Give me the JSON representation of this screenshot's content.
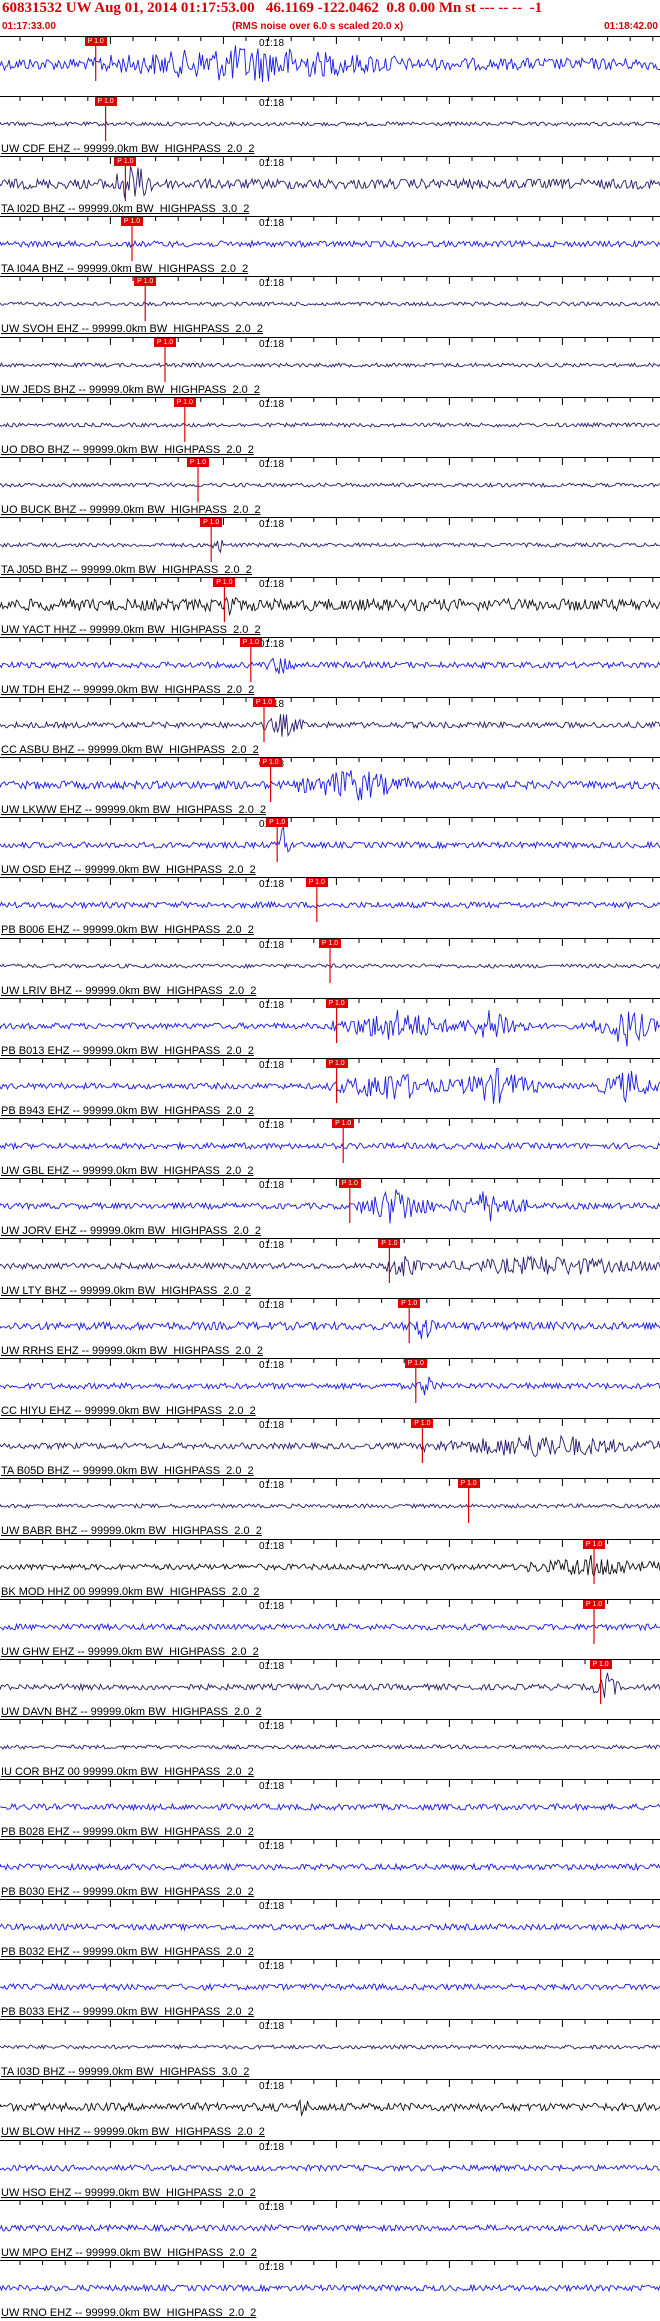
{
  "header": {
    "title": "60831532 UW Aug 01, 2014 01:17:53.00   46.1169 -122.0462  0.8 0.00 Mn st --- -- --  -1",
    "start_time": "01:17:33.00",
    "rms_note": "(RMS noise over 6.0 s scaled 20.0 x)",
    "end_time": "01:18:42.00"
  },
  "tick_label": "01:18",
  "pick_label": "P 1.0",
  "colors": {
    "header": "#d40000",
    "pick": "#e00000",
    "black": "#111111",
    "blue": "#1a1ae6",
    "purple": "#2a1a6e"
  },
  "panels": [
    {
      "station": "",
      "pick": 0.145,
      "amp": 6,
      "color": "blue",
      "burst": [
        [
          0.15,
          0.6,
          14
        ]
      ]
    },
    {
      "station": "UW CDF EHZ -- 99999.0km BW  HIGHPASS  2.0  2",
      "pick": 0.16,
      "amp": 2,
      "color": "purple",
      "burst": []
    },
    {
      "station": "TA I02D BHZ -- 99999.0km BW  HIGHPASS  3.0  2",
      "pick": 0.19,
      "amp": 5,
      "color": "purple",
      "burst": [
        [
          0.16,
          0.24,
          16
        ]
      ]
    },
    {
      "station": "TA I04A BHZ -- 99999.0km BW  HIGHPASS  2.0  2",
      "pick": 0.2,
      "amp": 3,
      "color": "blue",
      "burst": []
    },
    {
      "station": "UW SVOH EHZ -- 99999.0km BW  HIGHPASS  2.0  2",
      "pick": 0.22,
      "amp": 2,
      "color": "purple",
      "burst": []
    },
    {
      "station": "UW JEDS BHZ -- 99999.0km BW  HIGHPASS  2.0  2",
      "pick": 0.25,
      "amp": 2,
      "color": "purple",
      "burst": []
    },
    {
      "station": "UO DBO BHZ -- 99999.0km BW  HIGHPASS  2.0  2",
      "pick": 0.28,
      "amp": 2,
      "color": "purple",
      "burst": []
    },
    {
      "station": "UO BUCK BHZ -- 99999.0km BW  HIGHPASS  2.0  2",
      "pick": 0.3,
      "amp": 2,
      "color": "purple",
      "burst": []
    },
    {
      "station": "TA J05D BHZ -- 99999.0km BW  HIGHPASS  2.0  2",
      "pick": 0.32,
      "amp": 2,
      "color": "purple",
      "burst": [
        [
          0.32,
          0.34,
          10
        ]
      ]
    },
    {
      "station": "UW YACT HHZ -- 99999.0km BW  HIGHPASS  2.0  2",
      "pick": 0.34,
      "amp": 6,
      "color": "black",
      "burst": [
        [
          0.33,
          0.36,
          10
        ]
      ]
    },
    {
      "station": "UW TDH EHZ -- 99999.0km BW  HIGHPASS  2.0  2",
      "pick": 0.38,
      "amp": 3,
      "color": "blue",
      "burst": [
        [
          0.4,
          0.45,
          8
        ]
      ]
    },
    {
      "station": "CC ASBU BHZ -- 99999.0km BW  HIGHPASS  2.0  2",
      "pick": 0.4,
      "amp": 3,
      "color": "purple",
      "burst": [
        [
          0.4,
          0.46,
          10
        ]
      ]
    },
    {
      "station": "UW LKWW EHZ -- 99999.0km BW  HIGHPASS  2.0  2",
      "pick": 0.41,
      "amp": 4,
      "color": "blue",
      "burst": [
        [
          0.45,
          0.62,
          14
        ]
      ]
    },
    {
      "station": "UW OSD EHZ -- 99999.0km BW  HIGHPASS  2.0  2",
      "pick": 0.42,
      "amp": 3,
      "color": "blue",
      "burst": [
        [
          0.42,
          0.44,
          18
        ]
      ]
    },
    {
      "station": "PB B006 EHZ -- 99999.0km BW  HIGHPASS  2.0  2",
      "pick": 0.48,
      "amp": 3,
      "color": "blue",
      "burst": []
    },
    {
      "station": "UW LRIV BHZ -- 99999.0km BW  HIGHPASS  2.0  2",
      "pick": 0.5,
      "amp": 2,
      "color": "purple",
      "burst": []
    },
    {
      "station": "PB B013 EHZ -- 99999.0km BW  HIGHPASS  2.0  2",
      "pick": 0.51,
      "amp": 3,
      "color": "blue",
      "burst": [
        [
          0.5,
          0.7,
          14
        ],
        [
          0.7,
          0.8,
          16
        ],
        [
          0.9,
          1.0,
          18
        ]
      ]
    },
    {
      "station": "PB B943 EHZ -- 99999.0km BW  HIGHPASS  2.0  2",
      "pick": 0.51,
      "amp": 3,
      "color": "blue",
      "burst": [
        [
          0.5,
          0.68,
          14
        ],
        [
          0.68,
          0.82,
          16
        ],
        [
          0.9,
          1.0,
          14
        ]
      ]
    },
    {
      "station": "UW GBL EHZ -- 99999.0km BW  HIGHPASS  2.0  2",
      "pick": 0.52,
      "amp": 3,
      "color": "blue",
      "burst": []
    },
    {
      "station": "UW JORV EHZ -- 99999.0km BW  HIGHPASS  2.0  2",
      "pick": 0.53,
      "amp": 3,
      "color": "blue",
      "burst": [
        [
          0.54,
          0.66,
          18
        ],
        [
          0.68,
          0.8,
          14
        ]
      ]
    },
    {
      "station": "UW LTY BHZ -- 99999.0km BW  HIGHPASS  2.0  2",
      "pick": 0.59,
      "amp": 3,
      "color": "purple",
      "burst": [
        [
          0.58,
          0.64,
          12
        ],
        [
          0.66,
          1.0,
          8
        ]
      ]
    },
    {
      "station": "UW RRHS EHZ -- 99999.0km BW  HIGHPASS  2.0  2",
      "pick": 0.62,
      "amp": 4,
      "color": "blue",
      "burst": [
        [
          0.62,
          0.66,
          12
        ]
      ]
    },
    {
      "station": "CC HIYU EHZ -- 99999.0km BW  HIGHPASS  2.0  2",
      "pick": 0.63,
      "amp": 3,
      "color": "blue",
      "burst": [
        [
          0.63,
          0.66,
          10
        ]
      ]
    },
    {
      "station": "TA B05D BHZ -- 99999.0km BW  HIGHPASS  2.0  2",
      "pick": 0.64,
      "amp": 3,
      "color": "purple",
      "burst": [
        [
          0.64,
          1.0,
          10
        ]
      ]
    },
    {
      "station": "UW BABR BHZ -- 99999.0km BW  HIGHPASS  2.0  2",
      "pick": 0.71,
      "amp": 2,
      "color": "purple",
      "burst": []
    },
    {
      "station": "BK MOD HHZ 00 99999.0km BW  HIGHPASS  2.0  2",
      "pick": 0.9,
      "amp": 3,
      "color": "black",
      "burst": [
        [
          0.8,
          1.0,
          10
        ]
      ]
    },
    {
      "station": "UW GHW EHZ -- 99999.0km BW  HIGHPASS  2.0  2",
      "pick": 0.9,
      "amp": 3,
      "color": "blue",
      "burst": []
    },
    {
      "station": "UW DAVN BHZ -- 99999.0km BW  HIGHPASS  2.0  2",
      "pick": 0.91,
      "amp": 3,
      "color": "purple",
      "burst": [
        [
          0.9,
          0.94,
          12
        ]
      ]
    },
    {
      "station": "IU COR BHZ 00 99999.0km BW  HIGHPASS  2.0  2",
      "pick": null,
      "amp": 2,
      "color": "purple",
      "burst": []
    },
    {
      "station": "PB B028 EHZ -- 99999.0km BW  HIGHPASS  2.0  2",
      "pick": null,
      "amp": 3,
      "color": "blue",
      "burst": []
    },
    {
      "station": "PB B030 EHZ -- 99999.0km BW  HIGHPASS  2.0  2",
      "pick": null,
      "amp": 3,
      "color": "blue",
      "burst": []
    },
    {
      "station": "PB B032 EHZ -- 99999.0km BW  HIGHPASS  2.0  2",
      "pick": null,
      "amp": 3,
      "color": "blue",
      "burst": []
    },
    {
      "station": "PB B033 EHZ -- 99999.0km BW  HIGHPASS  2.0  2",
      "pick": null,
      "amp": 3,
      "color": "blue",
      "burst": []
    },
    {
      "station": "TA I03D BHZ -- 99999.0km BW  HIGHPASS  3.0  2",
      "pick": null,
      "amp": 2,
      "color": "purple",
      "burst": []
    },
    {
      "station": "UW BLOW HHZ -- 99999.0km BW  HIGHPASS  2.0  2",
      "pick": null,
      "amp": 4,
      "color": "black",
      "burst": [
        [
          0.45,
          0.47,
          8
        ]
      ]
    },
    {
      "station": "UW HSO EHZ -- 99999.0km BW  HIGHPASS  2.0  2",
      "pick": null,
      "amp": 3,
      "color": "blue",
      "burst": []
    },
    {
      "station": "UW MPO EHZ -- 99999.0km BW  HIGHPASS  2.0  2",
      "pick": null,
      "amp": 3,
      "color": "blue",
      "burst": []
    },
    {
      "station": "UW RNO EHZ -- 99999.0km BW  HIGHPASS  2.0  2",
      "pick": null,
      "amp": 3,
      "color": "blue",
      "burst": []
    }
  ]
}
